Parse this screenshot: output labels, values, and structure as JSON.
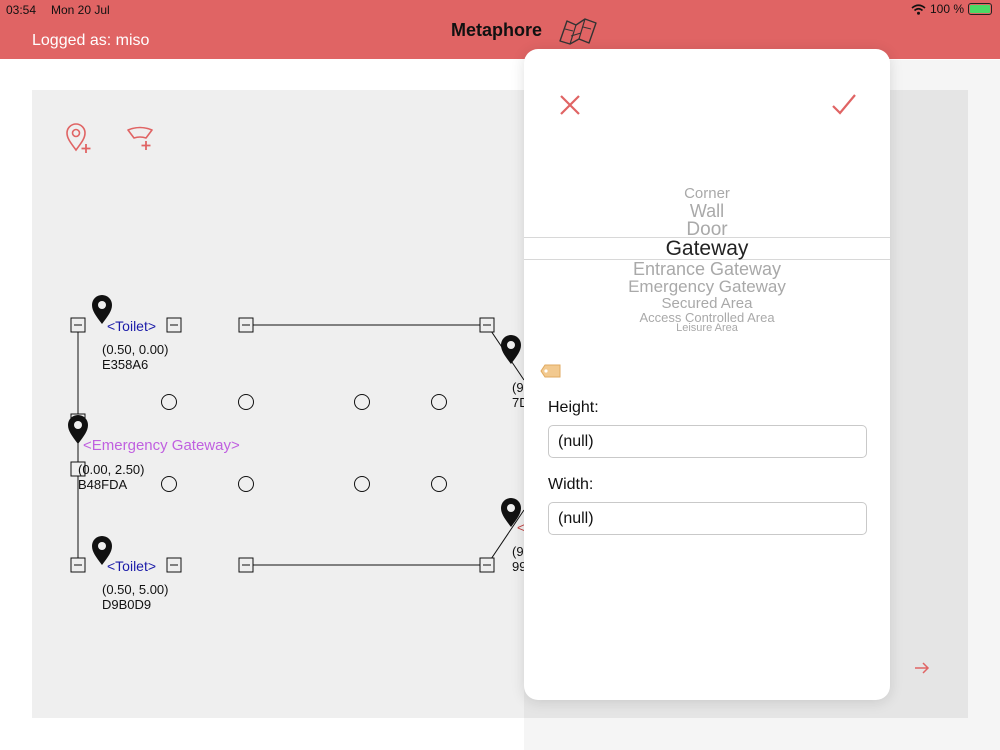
{
  "status_bar": {
    "time": "03:54",
    "date": "Mon 20 Jul",
    "battery": "100 %",
    "battery_level": 1.0
  },
  "header": {
    "logged_as": "Logged as: miso",
    "title": "Metaphore"
  },
  "colors": {
    "accent": "#e06464",
    "canvas": "#efefef",
    "toilet_label": "#1a1aa8",
    "emergency_label": "#c060e0"
  },
  "toolbar": {
    "add_pin_icon": "pin-add-icon",
    "add_area_icon": "fan-area-add-icon"
  },
  "map": {
    "labels": {
      "toilet_top": "<Toilet>",
      "toilet_top_coords": "(0.50, 0.00)",
      "toilet_top_id": "E358A6",
      "emergency": "<Emergency Gateway>",
      "emergency_coords": "(0.00, 2.50)",
      "emergency_id": "B48FDA",
      "toilet_bottom": "<Toilet>",
      "toilet_bottom_coords": "(0.50, 5.00)",
      "toilet_bottom_id": "D9B0D9",
      "right_upper_coords": "(9",
      "right_upper_id": "7D",
      "right_lower_name": "<",
      "right_lower_coords": "(9",
      "right_lower_id": "99"
    }
  },
  "modal": {
    "picker_items": [
      "Corner",
      "Wall",
      "Door",
      "Gateway",
      "Entrance Gateway",
      "Emergency Gateway",
      "Secured Area",
      "Access Controlled Area",
      "Leisure Area"
    ],
    "selected": "Gateway",
    "height_label": "Height:",
    "height_value": "(null)",
    "width_label": "Width:",
    "width_value": "(null)"
  }
}
